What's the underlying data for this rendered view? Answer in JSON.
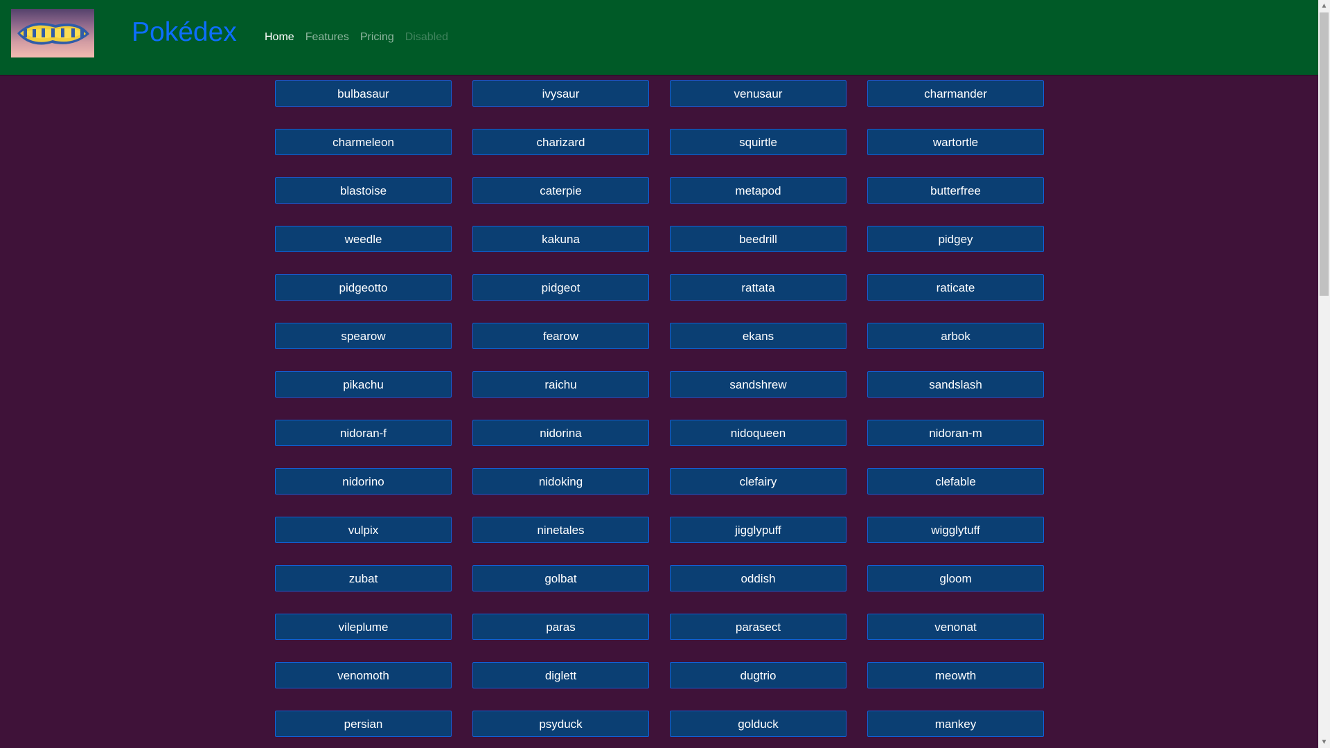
{
  "navbar": {
    "brand": "Pokédex",
    "logo_text": "Pokémon",
    "links": [
      {
        "label": "Home",
        "active": true
      },
      {
        "label": "Features"
      },
      {
        "label": "Pricing"
      },
      {
        "label": "Disabled",
        "disabled": true
      }
    ]
  },
  "pokemon": [
    "bulbasaur",
    "ivysaur",
    "venusaur",
    "charmander",
    "charmeleon",
    "charizard",
    "squirtle",
    "wartortle",
    "blastoise",
    "caterpie",
    "metapod",
    "butterfree",
    "weedle",
    "kakuna",
    "beedrill",
    "pidgey",
    "pidgeotto",
    "pidgeot",
    "rattata",
    "raticate",
    "spearow",
    "fearow",
    "ekans",
    "arbok",
    "pikachu",
    "raichu",
    "sandshrew",
    "sandslash",
    "nidoran-f",
    "nidorina",
    "nidoqueen",
    "nidoran-m",
    "nidorino",
    "nidoking",
    "clefairy",
    "clefable",
    "vulpix",
    "ninetales",
    "jigglypuff",
    "wigglytuff",
    "zubat",
    "golbat",
    "oddish",
    "gloom",
    "vileplume",
    "paras",
    "parasect",
    "venonat",
    "venomoth",
    "diglett",
    "dugtrio",
    "meowth",
    "persian",
    "psyduck",
    "golduck",
    "mankey"
  ],
  "colors": {
    "page_background": "#3f1239",
    "navbar": "#005a27",
    "brand": "#0d6efd",
    "button_background": "#0b3f73",
    "button_border": "#1260d6"
  },
  "icons": {
    "logo": "pokemon-logo-icon",
    "scroll_up": "triangle-up-icon",
    "scroll_down": "triangle-down-icon"
  }
}
